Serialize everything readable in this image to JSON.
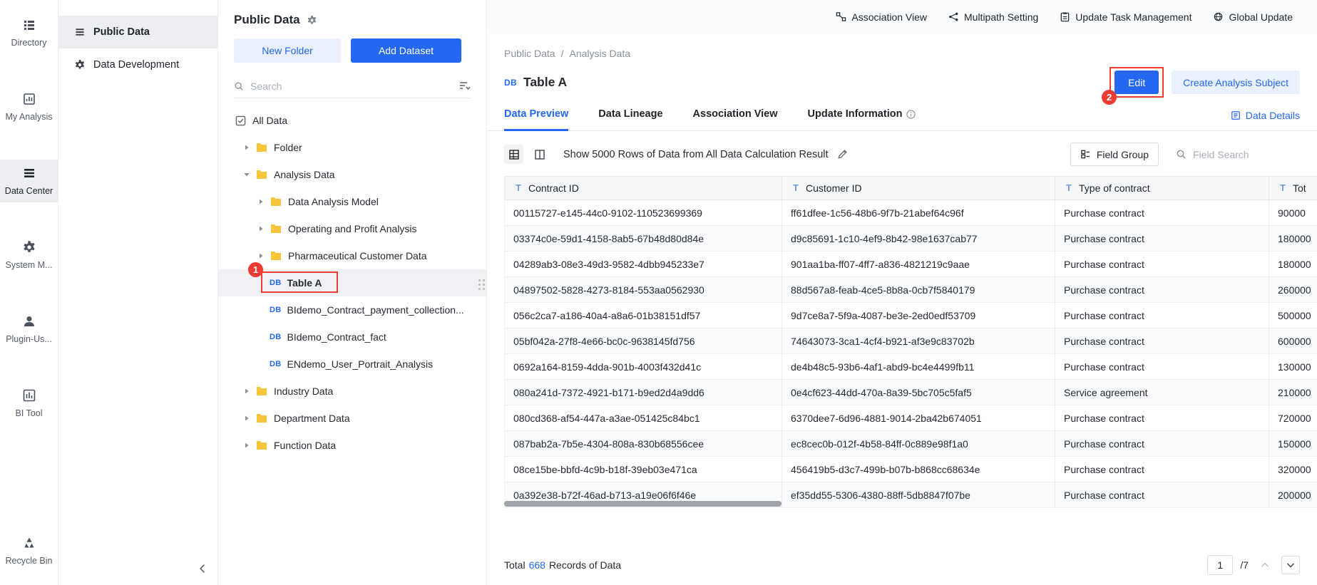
{
  "annotations": {
    "step1": "1",
    "step2": "2"
  },
  "colors": {
    "accent": "#2468f2",
    "annotation_red": "#ee3b33",
    "folder_yellow": "#f7c53c"
  },
  "nav_rail": {
    "items": [
      {
        "label": "Directory",
        "icon": "directory-icon"
      },
      {
        "label": "My Analysis",
        "icon": "my-analysis-icon"
      },
      {
        "label": "Data Center",
        "icon": "data-center-icon",
        "active": true
      },
      {
        "label": "System M...",
        "icon": "system-management-icon"
      },
      {
        "label": "Plugin-Us...",
        "icon": "plugin-users-icon"
      },
      {
        "label": "BI Tool",
        "icon": "bi-tool-icon"
      },
      {
        "label": "Recycle Bin",
        "icon": "recycle-bin-icon"
      }
    ]
  },
  "module_panel": {
    "items": [
      {
        "label": "Public Data",
        "icon": "public-data-icon",
        "active": true
      },
      {
        "label": "Data Development",
        "icon": "data-development-icon"
      }
    ]
  },
  "tree_panel": {
    "title": "Public Data",
    "new_folder_label": "New Folder",
    "add_dataset_label": "Add Dataset",
    "search_placeholder": "Search",
    "items": [
      {
        "label": "All Data"
      },
      {
        "label": "Folder"
      },
      {
        "label": "Analysis Data"
      },
      {
        "label": "Data Analysis Model"
      },
      {
        "label": "Operating and Profit Analysis"
      },
      {
        "label": "Pharmaceutical Customer Data"
      },
      {
        "label": "Table A",
        "selected": true
      },
      {
        "label": "BIdemo_Contract_payment_collection..."
      },
      {
        "label": "BIdemo_Contract_fact"
      },
      {
        "label": "ENdemo_User_Portrait_Analysis"
      },
      {
        "label": "Industry Data"
      },
      {
        "label": "Department Data"
      },
      {
        "label": "Function Data"
      }
    ]
  },
  "top_toolbar": {
    "items": [
      {
        "label": "Association View",
        "icon": "association-view-icon"
      },
      {
        "label": "Multipath Setting",
        "icon": "multipath-setting-icon"
      },
      {
        "label": "Update Task Management",
        "icon": "update-task-icon"
      },
      {
        "label": "Global Update",
        "icon": "global-update-icon"
      }
    ]
  },
  "content": {
    "breadcrumb": {
      "root": "Public Data",
      "separator": "/",
      "current": "Analysis Data"
    },
    "db_badge": "DB",
    "title": "Table A",
    "edit_label": "Edit",
    "create_subject_label": "Create Analysis Subject",
    "tabs": [
      "Data Preview",
      "Data Lineage",
      "Association View",
      "Update Information"
    ],
    "data_details_label": "Data Details",
    "rows_info": "Show 5000 Rows of Data from All Data Calculation Result",
    "field_group_label": "Field Group",
    "field_search_placeholder": "Field Search",
    "table": {
      "columns": [
        "Contract ID",
        "Customer ID",
        "Type of contract",
        "Tot"
      ],
      "rows": [
        [
          "00115727-e145-44c0-9102-110523699369",
          "ff61dfee-1c56-48b6-9f7b-21abef64c96f",
          "Purchase contract",
          "90000"
        ],
        [
          "03374c0e-59d1-4158-8ab5-67b48d80d84e",
          "d9c85691-1c10-4ef9-8b42-98e1637cab77",
          "Purchase contract",
          "180000"
        ],
        [
          "04289ab3-08e3-49d3-9582-4dbb945233e7",
          "901aa1ba-ff07-4ff7-a836-4821219c9aae",
          "Purchase contract",
          "180000"
        ],
        [
          "04897502-5828-4273-8184-553aa0562930",
          "88d567a8-feab-4ce5-8b8a-0cb7f5840179",
          "Purchase contract",
          "260000"
        ],
        [
          "056c2ca7-a186-40a4-a8a6-01b38151df57",
          "9d7ce8a7-5f9a-4087-be3e-2ed0edf53709",
          "Purchase contract",
          "500000"
        ],
        [
          "05bf042a-27f8-4e66-bc0c-9638145fd756",
          "74643073-3ca1-4cf4-b921-af3e9c83702b",
          "Purchase contract",
          "600000"
        ],
        [
          "0692a164-8159-4dda-901b-4003f432d41c",
          "de4b48c5-93b6-4af1-abd9-bc4e4499fb11",
          "Purchase contract",
          "130000"
        ],
        [
          "080a241d-7372-4921-b171-b9ed2d4a9dd6",
          "0e4cf623-44dd-470a-8a39-5bc705c5faf5",
          "Service agreement",
          "210000"
        ],
        [
          "080cd368-af54-447a-a3ae-051425c84bc1",
          "6370dee7-6d96-4881-9014-2ba42b674051",
          "Purchase contract",
          "720000"
        ],
        [
          "087bab2a-7b5e-4304-808a-830b68556cee",
          "ec8cec0b-012f-4b58-84ff-0c889e98f1a0",
          "Purchase contract",
          "150000"
        ],
        [
          "08ce15be-bbfd-4c9b-b18f-39eb03e471ca",
          "456419b5-d3c7-499b-b07b-b868cc68634e",
          "Purchase contract",
          "320000"
        ],
        [
          "0a392e38-b72f-46ad-b713-a19e06f6f46e",
          "ef35dd55-5306-4380-88ff-5db8847f07be",
          "Purchase contract",
          "200000"
        ]
      ]
    },
    "footer": {
      "total_prefix": "Total",
      "total_count": "668",
      "total_suffix": "Records of Data",
      "page_value": "1",
      "page_total": "/7"
    }
  }
}
